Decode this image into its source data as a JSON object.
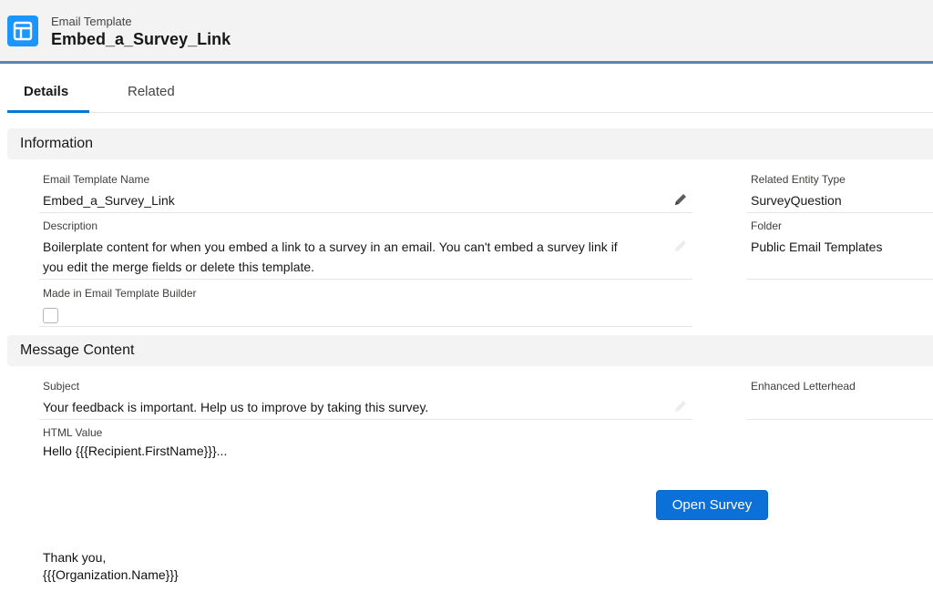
{
  "header": {
    "object_type": "Email Template",
    "record_name": "Embed_a_Survey_Link"
  },
  "tabs": [
    {
      "label": "Details",
      "active": true
    },
    {
      "label": "Related",
      "active": false
    }
  ],
  "information": {
    "section_title": "Information",
    "email_template_name": {
      "label": "Email Template Name",
      "value": "Embed_a_Survey_Link"
    },
    "description": {
      "label": "Description",
      "value_line1": "Boilerplate content for when you embed a link to a survey in an email. You can't embed a survey link if",
      "value_line2": "you edit the merge fields or delete this template."
    },
    "made_in_builder": {
      "label": "Made in Email Template Builder",
      "checked": false
    },
    "related_entity_type": {
      "label": "Related Entity Type",
      "value": "SurveyQuestion"
    },
    "folder": {
      "label": "Folder",
      "value": "Public Email Templates"
    }
  },
  "message_content": {
    "section_title": "Message Content",
    "subject": {
      "label": "Subject",
      "value": "Your feedback is important. Help us to improve by taking this survey."
    },
    "enhanced_letterhead": {
      "label": "Enhanced Letterhead",
      "value": ""
    },
    "html_value": {
      "label": "HTML Value",
      "greeting": "Hello {{{Recipient.FirstName}}}...",
      "button_label": "Open Survey",
      "closing": "Thank you,",
      "signature": "{{{Organization.Name}}}"
    }
  },
  "colors": {
    "brand_blue": "#0176d3",
    "button_blue": "#0b71d9",
    "header_bg": "#f3f3f3"
  },
  "icons": [
    "email-template-icon",
    "pencil-icon"
  ]
}
